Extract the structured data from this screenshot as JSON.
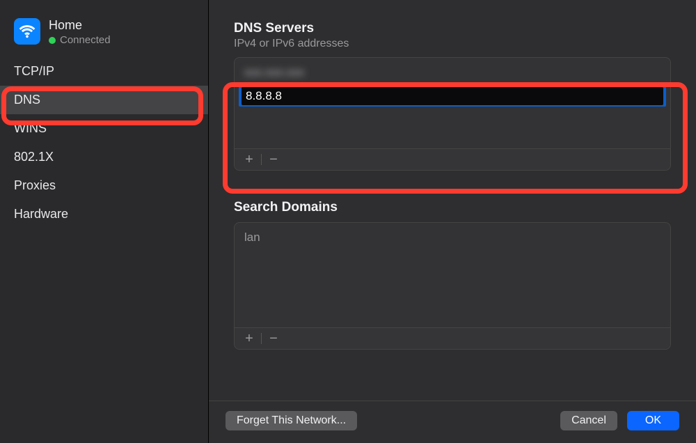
{
  "network": {
    "name": "Home",
    "status": "Connected"
  },
  "tabs": [
    {
      "label": "TCP/IP",
      "selected": false
    },
    {
      "label": "DNS",
      "selected": true
    },
    {
      "label": "WINS",
      "selected": false
    },
    {
      "label": "802.1X",
      "selected": false
    },
    {
      "label": "Proxies",
      "selected": false
    },
    {
      "label": "Hardware",
      "selected": false
    }
  ],
  "dns": {
    "title": "DNS Servers",
    "subtitle": "IPv4 or IPv6 addresses",
    "servers": [
      {
        "value": "xxx.xxx.xxx",
        "obscured": true
      },
      {
        "value": "8.8.8.8",
        "editing": true
      }
    ]
  },
  "search_domains": {
    "title": "Search Domains",
    "items": [
      {
        "value": "lan"
      }
    ]
  },
  "icons": {
    "plus": "+",
    "minus": "−"
  },
  "footer": {
    "forget": "Forget This Network...",
    "cancel": "Cancel",
    "ok": "OK"
  }
}
